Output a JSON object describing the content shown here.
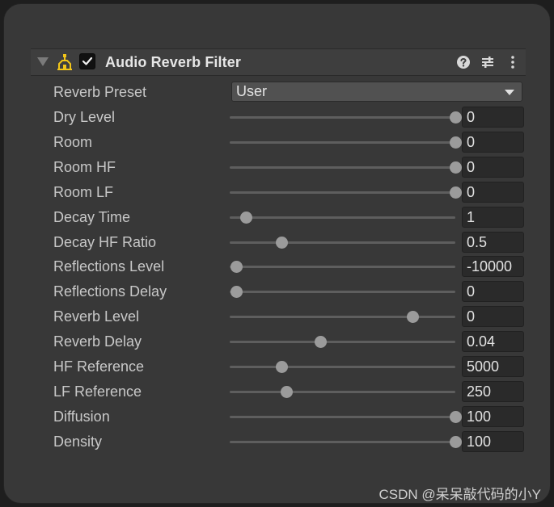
{
  "component": {
    "title": "Audio Reverb Filter",
    "enabled": true,
    "icons": [
      "foldout-arrow-icon",
      "audio-reverb-component-icon",
      "checkmark-icon",
      "help-icon",
      "preset-sliders-icon",
      "more-menu-icon"
    ]
  },
  "preset": {
    "label": "Reverb Preset",
    "value": "User"
  },
  "properties": [
    {
      "label": "Dry Level",
      "value": "0",
      "slider_fraction": 1.0
    },
    {
      "label": "Room",
      "value": "0",
      "slider_fraction": 1.0
    },
    {
      "label": "Room HF",
      "value": "0",
      "slider_fraction": 1.0
    },
    {
      "label": "Room LF",
      "value": "0",
      "slider_fraction": 1.0
    },
    {
      "label": "Decay Time",
      "value": "1",
      "slider_fraction": 0.07
    },
    {
      "label": "Decay HF Ratio",
      "value": "0.5",
      "slider_fraction": 0.23
    },
    {
      "label": "Reflections Level",
      "value": "-10000",
      "slider_fraction": 0.03
    },
    {
      "label": "Reflections Delay",
      "value": "0",
      "slider_fraction": 0.03
    },
    {
      "label": "Reverb Level",
      "value": "0",
      "slider_fraction": 0.81
    },
    {
      "label": "Reverb Delay",
      "value": "0.04",
      "slider_fraction": 0.4
    },
    {
      "label": "HF Reference",
      "value": "5000",
      "slider_fraction": 0.23
    },
    {
      "label": "LF Reference",
      "value": "250",
      "slider_fraction": 0.25
    },
    {
      "label": "Diffusion",
      "value": "100",
      "slider_fraction": 1.0
    },
    {
      "label": "Density",
      "value": "100",
      "slider_fraction": 1.0
    }
  ],
  "watermark": "CSDN @呆呆敲代码的小Y",
  "colors": {
    "panel": "#383838",
    "accent_icon": "#f0c419",
    "slider_thumb": "#9b9b9b"
  }
}
